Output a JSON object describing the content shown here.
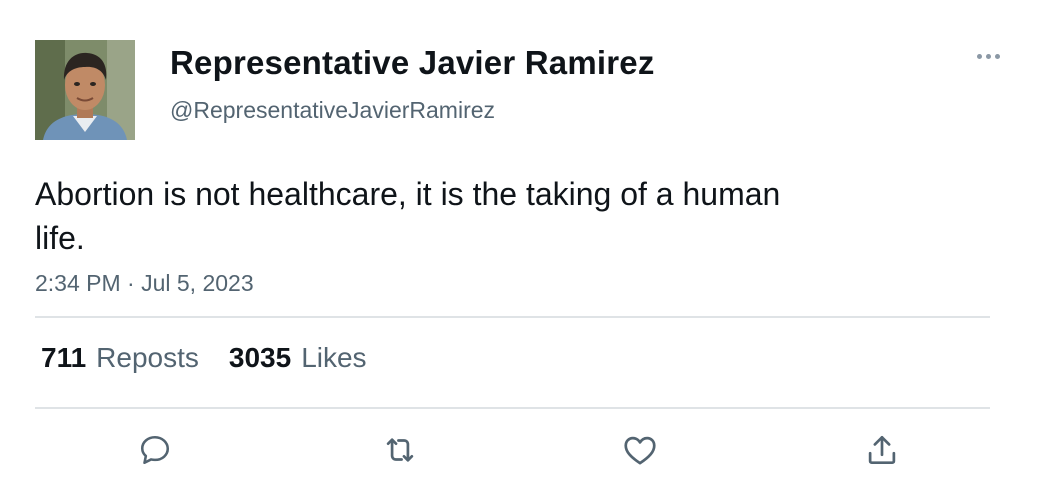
{
  "author": {
    "display_name": "Representative Javier Ramirez",
    "handle": "@RepresentativeJavierRamirez",
    "avatar_icon": "profile-photo"
  },
  "tweet": {
    "text": "Abortion is not healthcare, it is the taking of a human life.",
    "timestamp": "2:34 PM · Jul 5, 2023"
  },
  "stats": {
    "reposts_count": "711",
    "reposts_label": "Reposts",
    "likes_count": "3035",
    "likes_label": "Likes"
  },
  "actions": {
    "reply_icon": "speech-bubble-icon",
    "repost_icon": "repost-arrows-icon",
    "like_icon": "heart-icon",
    "share_icon": "share-upload-icon"
  },
  "more_icon": "ellipsis-icon",
  "colors": {
    "text_primary": "#0f1419",
    "text_secondary": "#536471",
    "icon_gray": "#536471",
    "divider": "#dfe3e6"
  }
}
